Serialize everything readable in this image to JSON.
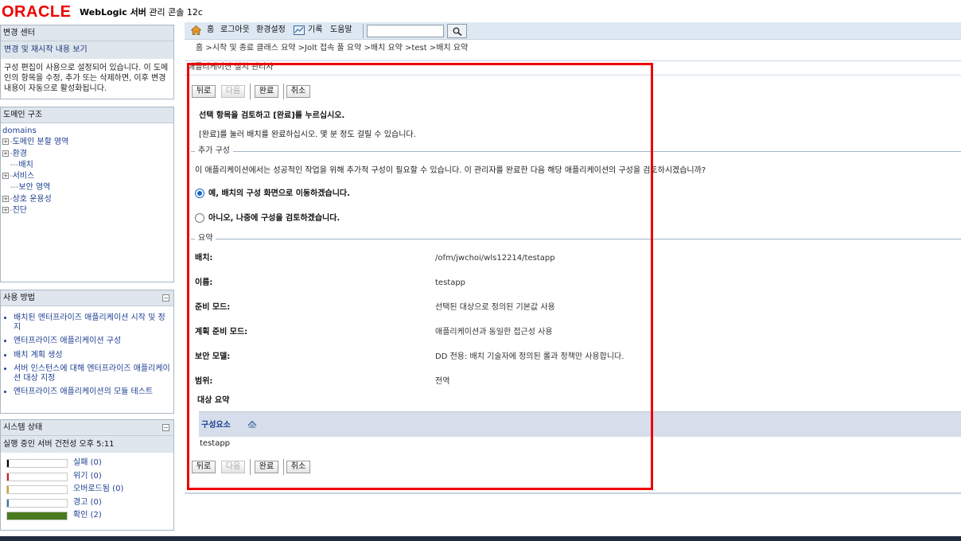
{
  "header": {
    "logo_text": "ORACLE",
    "brand": "WebLogic 서버",
    "subtitle": "관리 콘솔 12c"
  },
  "change_center": {
    "title": "변경 센터",
    "link": "변경 및 재시작 내용 보기",
    "description": "구성 편집이 사용으로 설정되어 있습니다. 이 도메인의 항목을 수정, 추가 또는 삭제하면, 이후 변경 내용이 자동으로 활성화됩니다."
  },
  "domain_structure": {
    "title": "도메인 구조",
    "root": "domains",
    "items": [
      {
        "label": "도메인 분할 영역",
        "expand": "+"
      },
      {
        "label": "환경",
        "expand": "+"
      },
      {
        "label": "배치",
        "expand": ""
      },
      {
        "label": "서비스",
        "expand": "+"
      },
      {
        "label": "보안 영역",
        "expand": ""
      },
      {
        "label": "상호 운용성",
        "expand": "+"
      },
      {
        "label": "진단",
        "expand": "+"
      }
    ]
  },
  "how_to": {
    "title": "사용 방법",
    "items": [
      "배치된 엔터프라이즈 애플리케이션 시작 및 정지",
      "엔터프라이즈 애플리케이션 구성",
      "배치 계획 생성",
      "서버 인스턴스에 대해 엔터프라이즈 애플리케이션 대상 지정",
      "엔터프라이즈 애플리케이션의 모듈 테스트"
    ]
  },
  "system_status": {
    "title": "시스템 상태",
    "subtitle": "실행 중인 서버 건전성  오후 5:11",
    "items": [
      {
        "label": "실패 (0)",
        "color": "#000000",
        "fill": 0
      },
      {
        "label": "위기 (0)",
        "color": "#cc2222",
        "fill": 0
      },
      {
        "label": "오버로드됨 (0)",
        "color": "#d9a422",
        "fill": 0
      },
      {
        "label": "경고 (0)",
        "color": "#3377aa",
        "fill": 0
      },
      {
        "label": "확인 (2)",
        "color": "#4a7a1e",
        "fill": 1
      }
    ]
  },
  "toolbar": {
    "home": "홈",
    "logout": "로그아웃",
    "preferences": "환경설정",
    "record": "기록",
    "help": "도움말",
    "search_value": ""
  },
  "breadcrumb": "홈 >시작 및 종료 클래스 요약 >Jolt 접속 풀 요약 >배치 요약 >test >배치 요약",
  "main": {
    "title": "애플리케이션 설치 관리자",
    "buttons": {
      "back": "뒤로",
      "next": "다음",
      "finish": "완료",
      "cancel": "취소"
    },
    "instruction_bold": "선택 항목을 검토하고 [완료]를 누르십시오.",
    "instruction": "[완료]를 눌러 배치를 완료하십시오. 몇 분 정도 걸릴 수 있습니다.",
    "additional_config": {
      "caption": "추가 구성",
      "text": "이 애플리케이션에서는 성공적인 작업을 위해 추가적 구성이 필요할 수 있습니다. 이 관리자를 완료한 다음 해당 애플리케이션의 구성을 검토하시겠습니까?",
      "option_yes": "예, 배치의 구성 화면으로 이동하겠습니다.",
      "option_no": "아니오, 나중에 구성을 검토하겠습니다."
    },
    "summary": {
      "caption": "요약",
      "rows": [
        {
          "label": "배치:",
          "value": "/ofm/jwchoi/wls12214/testapp"
        },
        {
          "label": "이름:",
          "value": "testapp"
        },
        {
          "label": "준비 모드:",
          "value": "선택된 대상으로 정의된 기본값 사용"
        },
        {
          "label": "계획 준비 모드:",
          "value": "애플리케이션과 동일한 접근성 사용"
        },
        {
          "label": "보안 모델:",
          "value": "DD 전용: 배치 기술자에 정의된 롤과 정책만 사용합니다."
        },
        {
          "label": "범위:",
          "value": "전역"
        }
      ],
      "target_summary": "대상 요약",
      "component_header": "구성요소",
      "component_value": "testapp"
    }
  }
}
